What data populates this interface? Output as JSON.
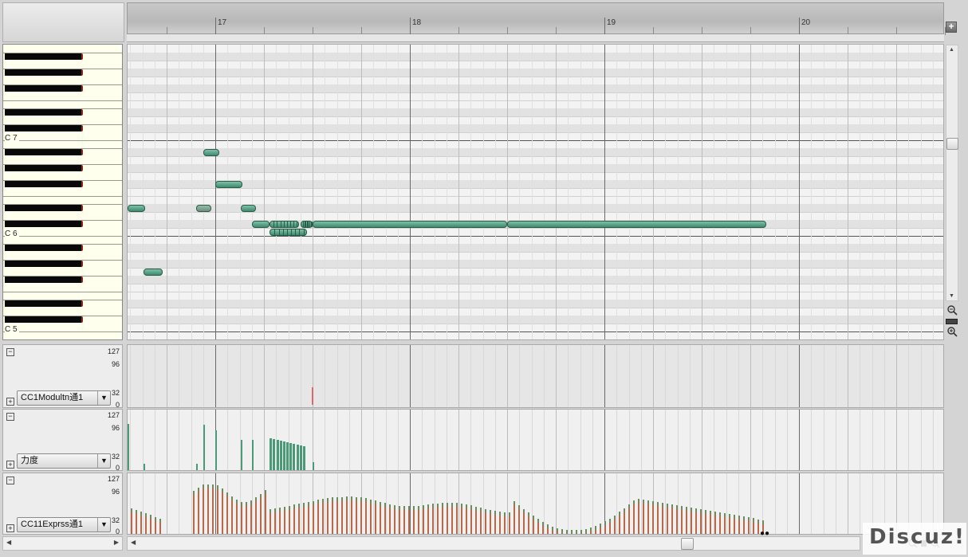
{
  "ruler": {
    "bars": [
      "17",
      "18",
      "19",
      "20"
    ]
  },
  "piano": {
    "labels": [
      "C 7",
      "C 6",
      "C 5"
    ]
  },
  "lanes": [
    {
      "controller": "CC1Modultn通1",
      "scale": [
        "127",
        "96",
        "32",
        "0"
      ]
    },
    {
      "controller": "力度",
      "scale": [
        "127",
        "96",
        "32",
        "0"
      ]
    },
    {
      "controller": "CC11Exprss通1",
      "scale": [
        "127",
        "96",
        "32",
        "0"
      ]
    }
  ],
  "controls": {
    "add_lane": "+",
    "zoom_out_icon": "zoom-out-icon",
    "zoom_in_icon": "zoom-in-icon",
    "collapse": "−",
    "expand": "+",
    "dropdown_caret": "▼"
  },
  "watermark": "Discuz!",
  "colors": {
    "note": "#4f9a7e",
    "velocity": "#4a9a78",
    "expression": "#b8694a",
    "modulation": "#d96a6a"
  },
  "notes": [
    {
      "start_bar": 16.55,
      "end_bar": 16.64,
      "pitch": "D#6"
    },
    {
      "start_bar": 16.63,
      "end_bar": 16.73,
      "pitch": "G5"
    },
    {
      "start_bar": 16.9,
      "end_bar": 16.98,
      "pitch": "D#6",
      "muted": true
    },
    {
      "start_bar": 16.94,
      "end_bar": 17.02,
      "pitch": "A#6"
    },
    {
      "start_bar": 17.0,
      "end_bar": 17.14,
      "pitch": "F#6"
    },
    {
      "start_bar": 17.13,
      "end_bar": 17.21,
      "pitch": "D#6"
    },
    {
      "start_bar": 17.19,
      "end_bar": 17.28,
      "pitch": "C#6"
    },
    {
      "start_bar": 17.28,
      "end_bar": 17.43,
      "pitch": "C#6"
    },
    {
      "start_bar": 17.28,
      "end_bar": 17.47,
      "pitch": "C6"
    },
    {
      "start_bar": 17.44,
      "end_bar": 17.5,
      "pitch": "C#6"
    },
    {
      "start_bar": 17.5,
      "end_bar": 18.5,
      "pitch": "C#6"
    },
    {
      "start_bar": 18.5,
      "end_bar": 19.83,
      "pitch": "C#6"
    }
  ]
}
